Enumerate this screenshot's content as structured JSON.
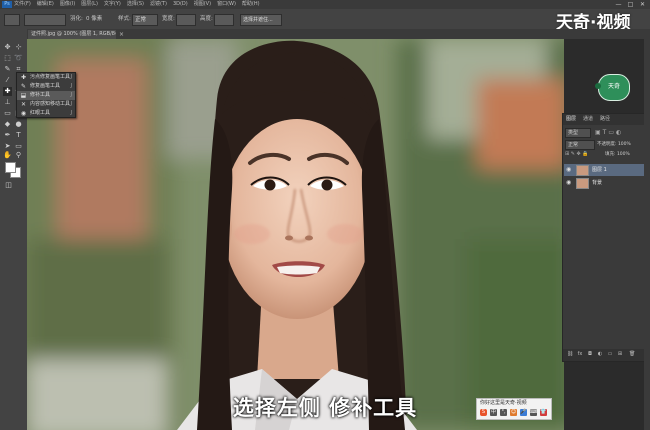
{
  "menubar": {
    "app_logo": "Ps",
    "items": [
      "文件(F)",
      "编辑(E)",
      "图像(I)",
      "图层(L)",
      "文字(Y)",
      "选择(S)",
      "滤镜(T)",
      "3D(D)",
      "视图(V)",
      "窗口(W)",
      "帮助(H)"
    ],
    "window_controls": [
      "—",
      "□",
      "✕"
    ]
  },
  "options_bar": {
    "feather_label": "羽化:",
    "feather_value": "0 像素",
    "style_label": "样式:",
    "style_value": "正常",
    "width_label": "宽度:",
    "height_label": "高度:",
    "refine_button": "选择并遮住..."
  },
  "watermark": "天奇·视频",
  "document_tab": {
    "title": "证件照.jpg @ 100% (图层 1, RGB/8#)",
    "close": "×"
  },
  "tool_flyout": {
    "items": [
      {
        "icon": "spot-healing-icon",
        "label": "污点修复画笔工具",
        "key": "J"
      },
      {
        "icon": "healing-brush-icon",
        "label": "修复画笔工具",
        "key": "J"
      },
      {
        "icon": "patch-icon",
        "label": "修补工具",
        "key": "J"
      },
      {
        "icon": "content-move-icon",
        "label": "内容感知移动工具",
        "key": "J"
      },
      {
        "icon": "red-eye-icon",
        "label": "红眼工具",
        "key": "J"
      }
    ]
  },
  "badge": {
    "label": "天奇"
  },
  "layers_panel": {
    "tabs": [
      "图层",
      "通道",
      "路径"
    ],
    "filter_label": "类型",
    "blend_mode": "正常",
    "opacity_label": "不透明度: 100%",
    "fill_label": "填充: 100%",
    "layers": [
      {
        "name": "图层 1",
        "active": true
      },
      {
        "name": "背景",
        "active": false
      }
    ]
  },
  "caption": "选择左侧 修补工具",
  "ime_bar": {
    "text": "你好这里是天奇·视频",
    "logo": "S",
    "icons": [
      "中",
      "°,",
      "☺",
      "🎤",
      "⌨",
      "👕"
    ]
  }
}
